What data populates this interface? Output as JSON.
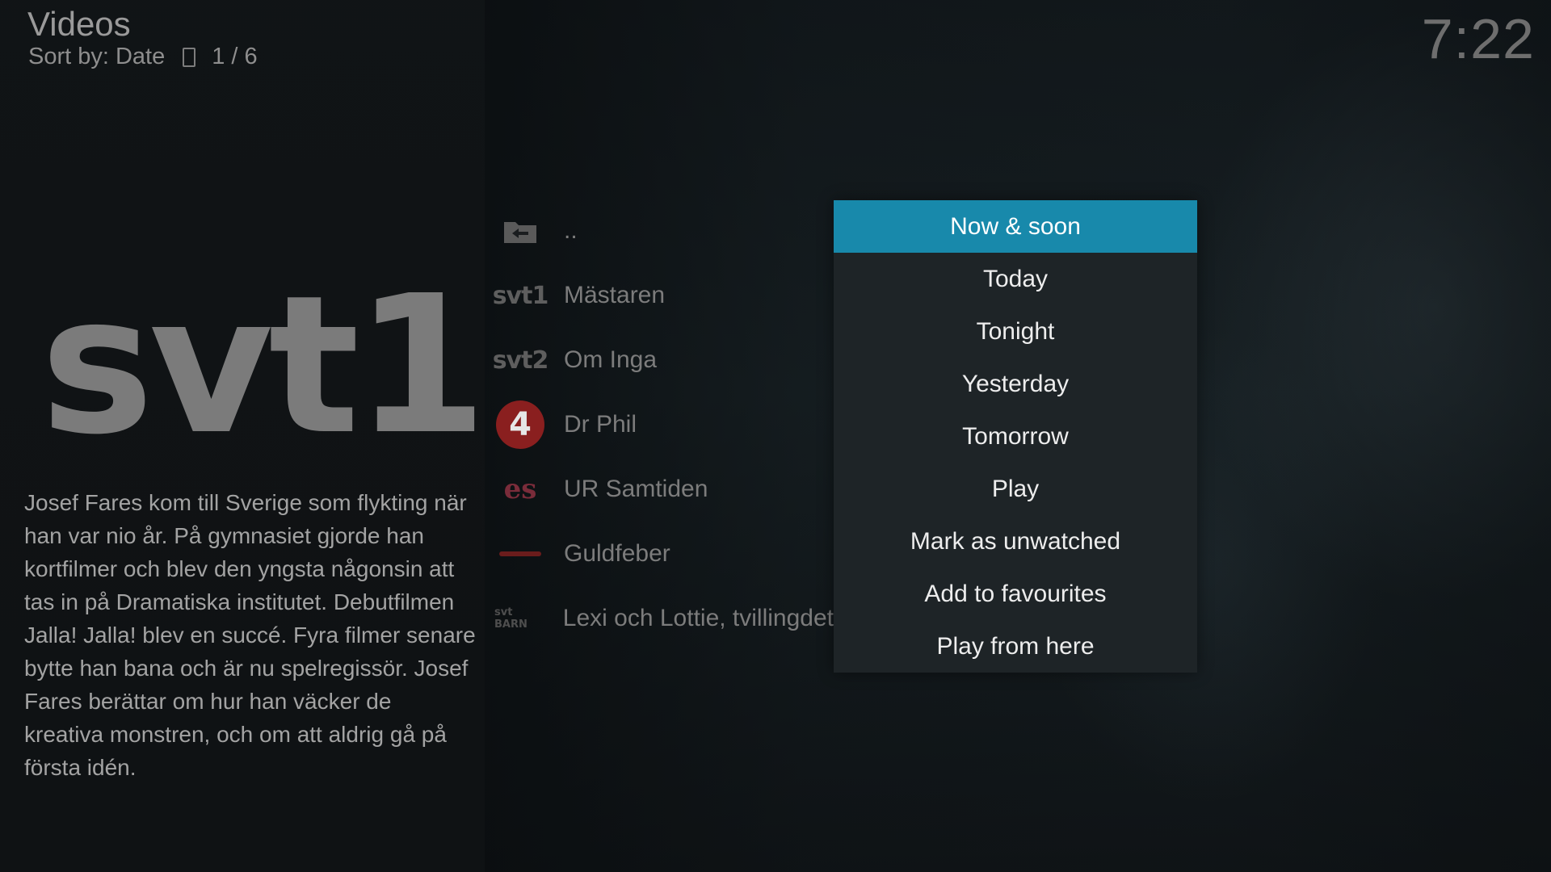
{
  "header": {
    "title": "Videos",
    "sort_label": "Sort by: Date",
    "page_position": "1 / 6",
    "clock": "7:22"
  },
  "info": {
    "channel_logo_text": "svt1",
    "plot": "Josef Fares kom till Sverige som flykting när han var nio år. På gymnasiet gjorde han kortfilmer och blev den yngsta någonsin att tas in på Dramatiska institutet. Debutfilmen Jalla! Jalla! blev en succé. Fyra filmer senare bytte han bana och är nu spelregissör. Josef Fares berättar om hur han väcker de kreativa monstren, och om att aldrig gå på första idén."
  },
  "list": {
    "items": [
      {
        "label": "..",
        "icon": "folder-back-icon"
      },
      {
        "label": "Mästaren",
        "icon": "svt1-logo-icon",
        "logo_text": "svt1"
      },
      {
        "label": "Om Inga",
        "icon": "svt2-logo-icon",
        "logo_text": "svt2"
      },
      {
        "label": "Dr Phil",
        "icon": "tv4-logo-icon",
        "logo_text": "4"
      },
      {
        "label": "UR Samtiden",
        "icon": "ur-logo-icon",
        "logo_text": "es"
      },
      {
        "label": "Guldfeber",
        "icon": "channel-logo-icon",
        "logo_text": ""
      },
      {
        "label": "Lexi och Lottie, tvillingdet",
        "icon": "svt-barn-logo-icon",
        "logo_text": "svt BARN"
      }
    ]
  },
  "context_menu": {
    "items": [
      {
        "label": "Now & soon",
        "focused": true
      },
      {
        "label": "Today",
        "focused": false
      },
      {
        "label": "Tonight",
        "focused": false
      },
      {
        "label": "Yesterday",
        "focused": false
      },
      {
        "label": "Tomorrow",
        "focused": false
      },
      {
        "label": "Play",
        "focused": false
      },
      {
        "label": "Mark as unwatched",
        "focused": false
      },
      {
        "label": "Add to favourites",
        "focused": false
      },
      {
        "label": "Play from here",
        "focused": false
      }
    ]
  },
  "colors": {
    "focus_accent": "#1889ab",
    "menu_background": "#1e2427"
  }
}
